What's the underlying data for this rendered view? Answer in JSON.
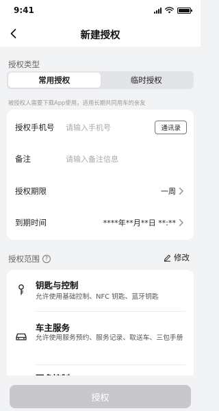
{
  "status_bar": {
    "time": "9:41"
  },
  "nav": {
    "title": "新建授权"
  },
  "auth_type": {
    "label": "授权类型",
    "tabs": [
      {
        "label": "常用授权",
        "active": true
      },
      {
        "label": "临时授权",
        "active": false
      }
    ],
    "hint": "被授权人需要下载App使用，适用长期共同用车的亲友"
  },
  "form": {
    "phone_label": "授权手机号",
    "phone_placeholder": "请输入手机号",
    "contacts_button": "通讯录",
    "remark_label": "备注",
    "remark_placeholder": "请输入备注信息",
    "period_label": "授权期限",
    "period_value": "一周",
    "expire_label": "到期时间",
    "expire_value": "****年**月**日 **:**"
  },
  "scope": {
    "label": "授权范围",
    "edit_label": "修改",
    "items": [
      {
        "title": "钥匙与控制",
        "desc": "允许使用基础控制、NFC 钥匙、蓝牙钥匙",
        "icon": "key-icon"
      },
      {
        "title": "车主服务",
        "desc": "允许使用服务预约、服务记录、取送车、三包手册",
        "icon": "car-icon"
      },
      {
        "title": "更多控制",
        "desc": "",
        "icon": ""
      }
    ]
  },
  "submit": {
    "label": "授权"
  },
  "colors": {
    "background": "#f2f3f5",
    "card": "#ffffff",
    "disabled_button": "#c8c8cc"
  }
}
